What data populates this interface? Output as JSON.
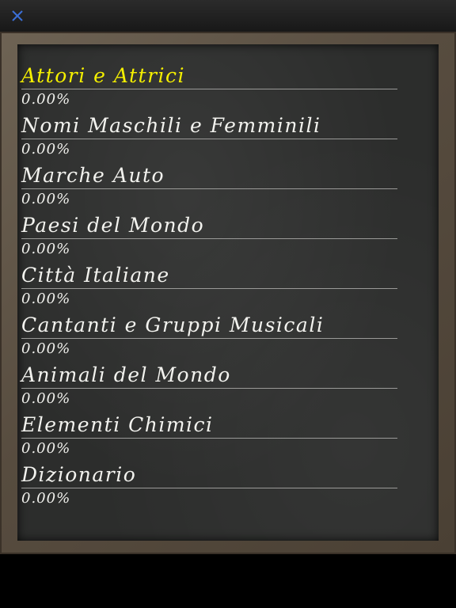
{
  "toolbar": {
    "close_icon": "close-icon",
    "accent_color": "#3b6fd6"
  },
  "board": {
    "selected_color": "#f5f000",
    "text_color": "#f2f2ee",
    "categories": [
      {
        "label": "Attori e Attrici",
        "percent": "0.00%",
        "selected": true
      },
      {
        "label": "Nomi Maschili e Femminili",
        "percent": "0.00%"
      },
      {
        "label": "Marche Auto",
        "percent": "0.00%"
      },
      {
        "label": "Paesi del Mondo",
        "percent": "0.00%"
      },
      {
        "label": "Città Italiane",
        "percent": "0.00%"
      },
      {
        "label": "Cantanti e Gruppi Musicali",
        "percent": "0.00%"
      },
      {
        "label": "Animali del Mondo",
        "percent": "0.00%"
      },
      {
        "label": "Elementi Chimici",
        "percent": "0.00%"
      },
      {
        "label": "Dizionario",
        "percent": "0.00%"
      }
    ]
  }
}
